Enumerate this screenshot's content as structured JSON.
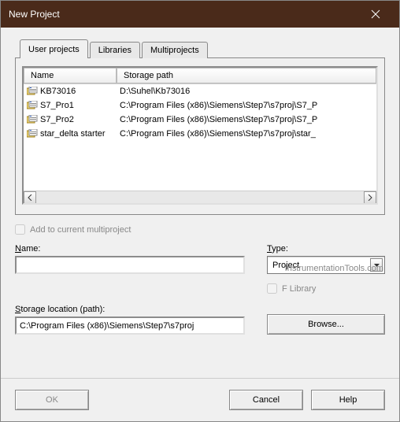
{
  "window": {
    "title": "New Project"
  },
  "tabs": [
    {
      "label": "User projects",
      "active": true
    },
    {
      "label": "Libraries",
      "active": false
    },
    {
      "label": "Multiprojects",
      "active": false
    }
  ],
  "list": {
    "columns": {
      "name": "Name",
      "path": "Storage path"
    },
    "rows": [
      {
        "name": "KB73016",
        "path": "D:\\Suhel\\Kb73016"
      },
      {
        "name": "S7_Pro1",
        "path": "C:\\Program Files (x86)\\Siemens\\Step7\\s7proj\\S7_P"
      },
      {
        "name": "S7_Pro2",
        "path": "C:\\Program Files (x86)\\Siemens\\Step7\\s7proj\\S7_P"
      },
      {
        "name": "star_delta starter",
        "path": "C:\\Program Files (x86)\\Siemens\\Step7\\s7proj\\star_"
      }
    ]
  },
  "add_multi": {
    "label": "Add to current multiproject",
    "checked": false
  },
  "watermark": "InstrumentationTools.com",
  "name_field": {
    "label_u": "N",
    "label_rest": "ame:",
    "value": ""
  },
  "type_field": {
    "label_u": "T",
    "label_rest": "ype:",
    "value": "Project"
  },
  "flib": {
    "label_u": "F",
    "label_rest": " Library",
    "checked": false
  },
  "storage": {
    "label_u": "S",
    "label_rest": "torage location (path):",
    "value": "C:\\Program Files (x86)\\Siemens\\Step7\\s7proj"
  },
  "buttons": {
    "browse": "Browse...",
    "ok": "OK",
    "cancel": "Cancel",
    "help": "Help"
  }
}
